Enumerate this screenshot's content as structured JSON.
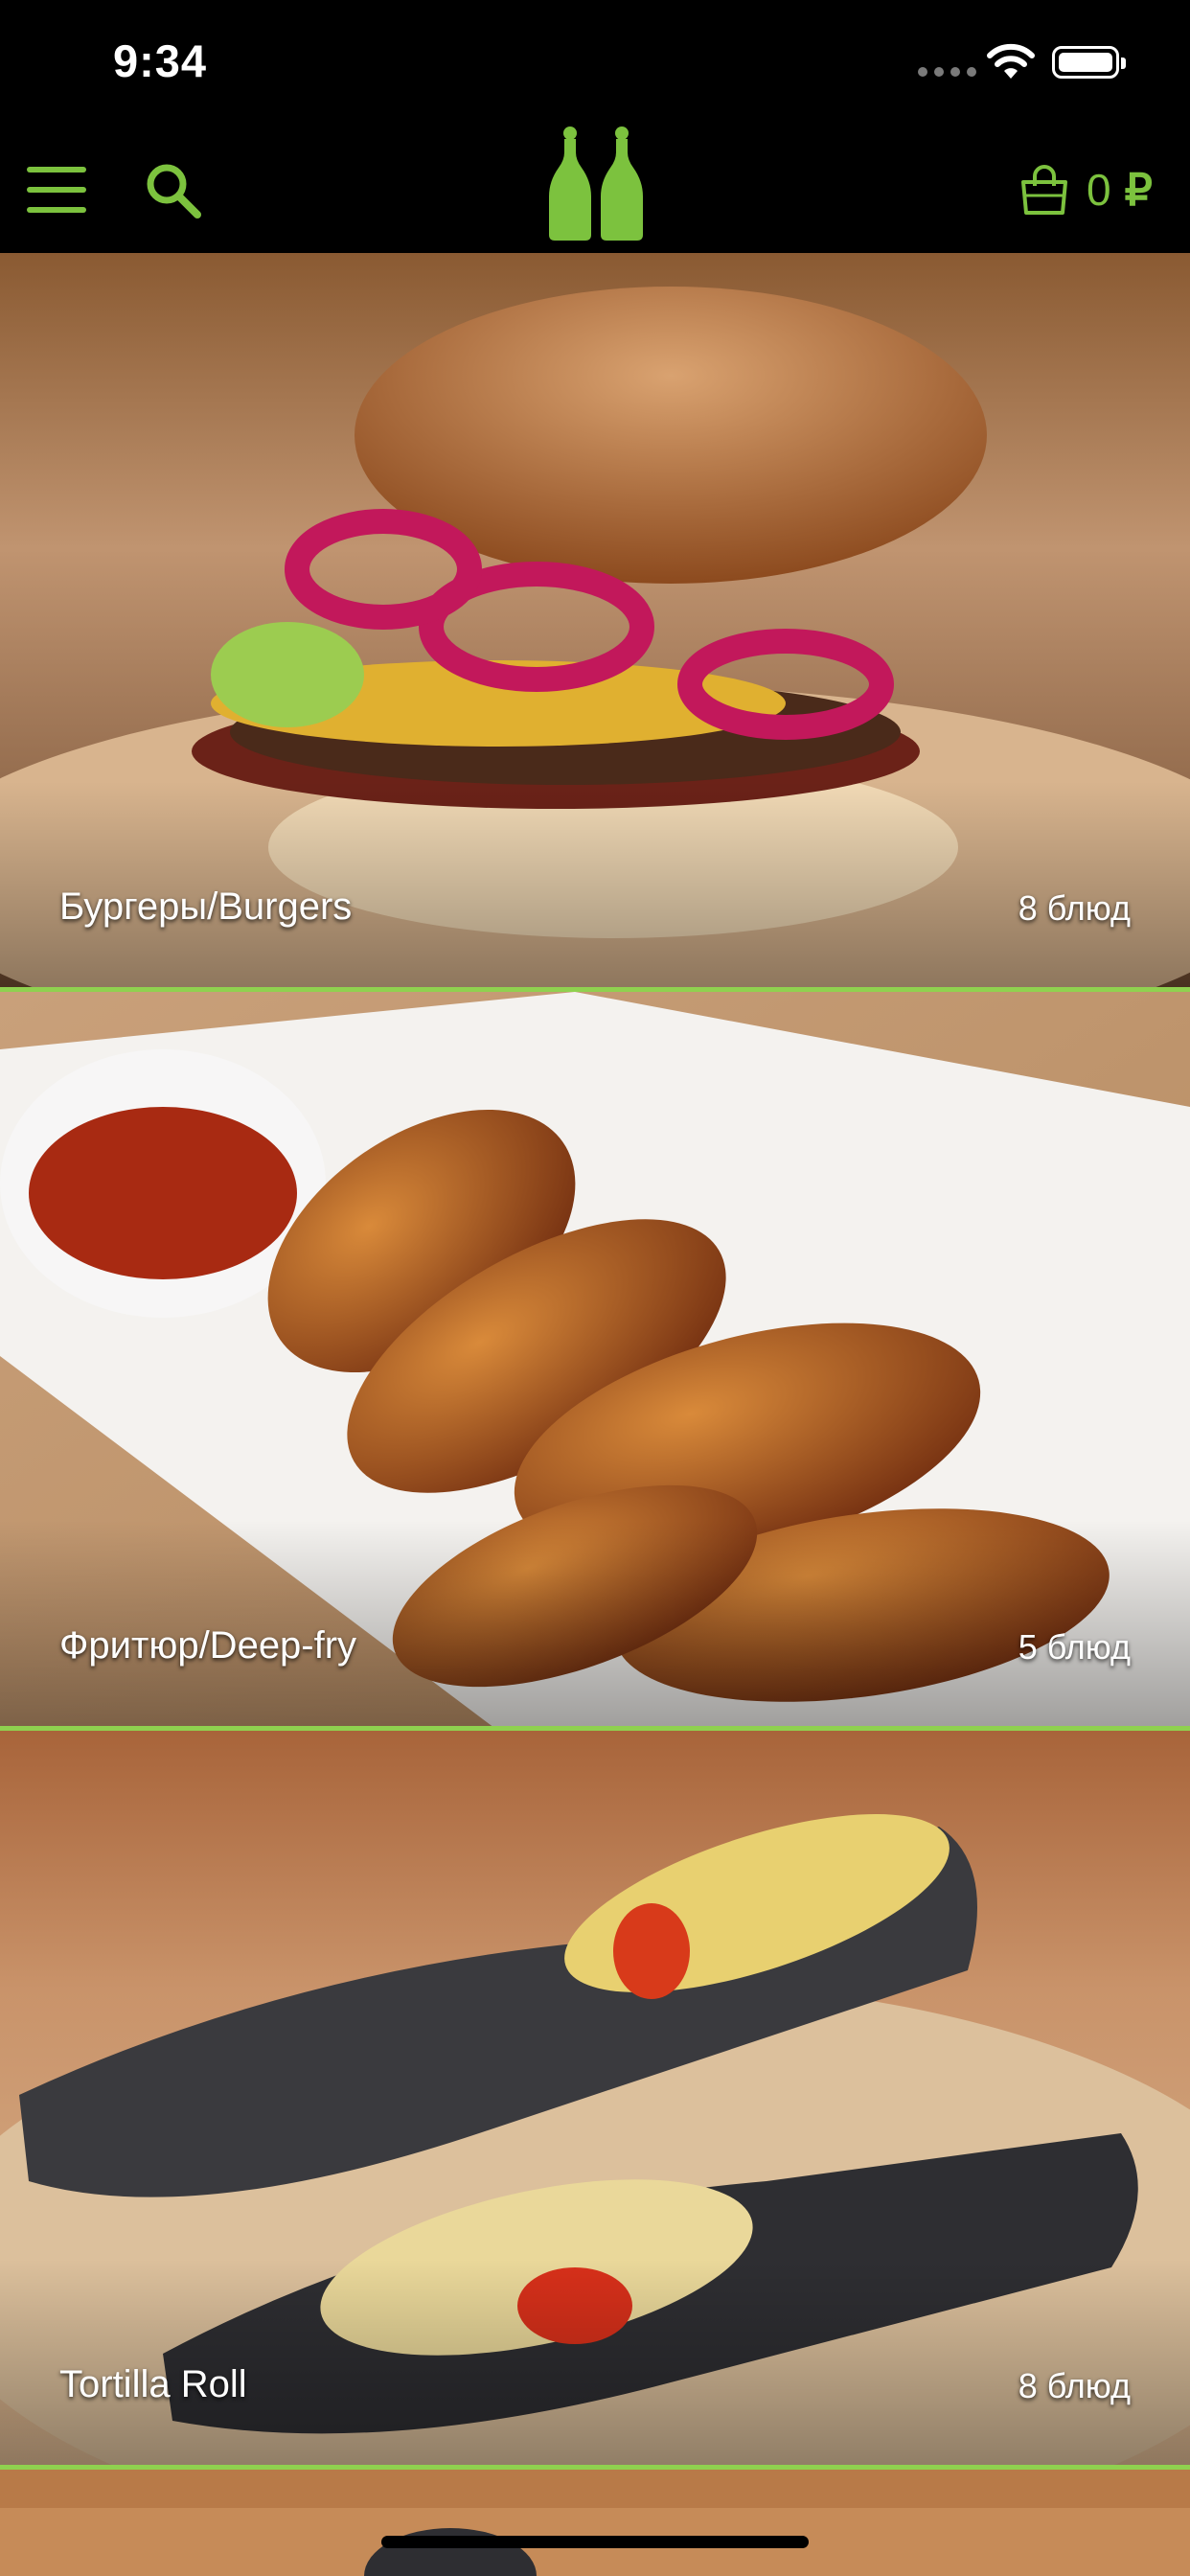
{
  "status_bar": {
    "time": "9:34"
  },
  "header": {
    "menu_icon": "hamburger-menu-icon",
    "search_icon": "search-icon",
    "logo_icon": "salt-pepper-logo-icon",
    "cart_icon": "shopping-bag-icon",
    "cart_count": "0",
    "currency": "₽"
  },
  "colors": {
    "accent": "#7cc23e",
    "background": "#000000"
  },
  "categories": [
    {
      "name": "Бургеры/Burgers",
      "count": "8 блюд"
    },
    {
      "name": "Фритюр/Deep-fry",
      "count": "5 блюд"
    },
    {
      "name": "Tortilla Roll",
      "count": "8 блюд"
    }
  ]
}
